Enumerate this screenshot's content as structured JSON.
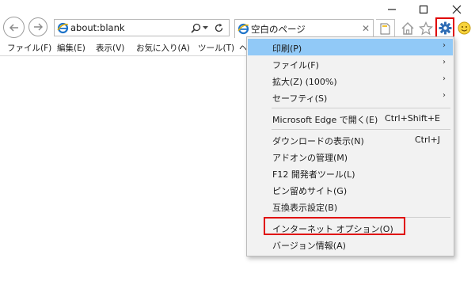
{
  "window": {
    "minimize_icon": "minimize-icon",
    "maximize_icon": "maximize-icon",
    "close_icon": "close-icon"
  },
  "nav": {
    "back_icon": "back-arrow-icon",
    "forward_icon": "forward-arrow-icon"
  },
  "address": {
    "url": "about:blank",
    "search_icon": "search-icon",
    "dropdown_icon": "chevron-down-icon",
    "refresh_icon": "refresh-icon"
  },
  "tab": {
    "title": "空白のページ",
    "close": "✕"
  },
  "toolbar": {
    "home_icon": "home-icon",
    "favorites_icon": "star-icon",
    "tools_icon": "gear-icon",
    "feedback_icon": "smiley-icon"
  },
  "menubar": {
    "items": [
      "ファイル(F)",
      "編集(E)",
      "表示(V)",
      "お気に入り(A)",
      "ツール(T)",
      "ヘ"
    ]
  },
  "tools_menu": {
    "items": [
      {
        "label": "印刷(P)",
        "shortcut": "",
        "submenu": true
      },
      {
        "label": "ファイル(F)",
        "shortcut": "",
        "submenu": true
      },
      {
        "label": "拡大(Z) (100%)",
        "shortcut": "",
        "submenu": true
      },
      {
        "label": "セーフティ(S)",
        "shortcut": "",
        "submenu": true
      },
      {
        "label": "Microsoft Edge で開く(E)",
        "shortcut": "Ctrl+Shift+E",
        "submenu": false
      },
      {
        "label": "ダウンロードの表示(N)",
        "shortcut": "Ctrl+J",
        "submenu": false
      },
      {
        "label": "アドオンの管理(M)",
        "shortcut": "",
        "submenu": false
      },
      {
        "label": "F12 開発者ツール(L)",
        "shortcut": "",
        "submenu": false
      },
      {
        "label": "ピン留めサイト(G)",
        "shortcut": "",
        "submenu": false
      },
      {
        "label": "互換表示設定(B)",
        "shortcut": "",
        "submenu": false
      },
      {
        "label": "インターネット オプション(O)",
        "shortcut": "",
        "submenu": false
      },
      {
        "label": "バージョン情報(A)",
        "shortcut": "",
        "submenu": false
      }
    ],
    "submenu_arrow": "›"
  },
  "colors": {
    "highlight": "#91c9f7",
    "annotation_red": "#e00000",
    "gear_blue": "#2f6db5"
  }
}
